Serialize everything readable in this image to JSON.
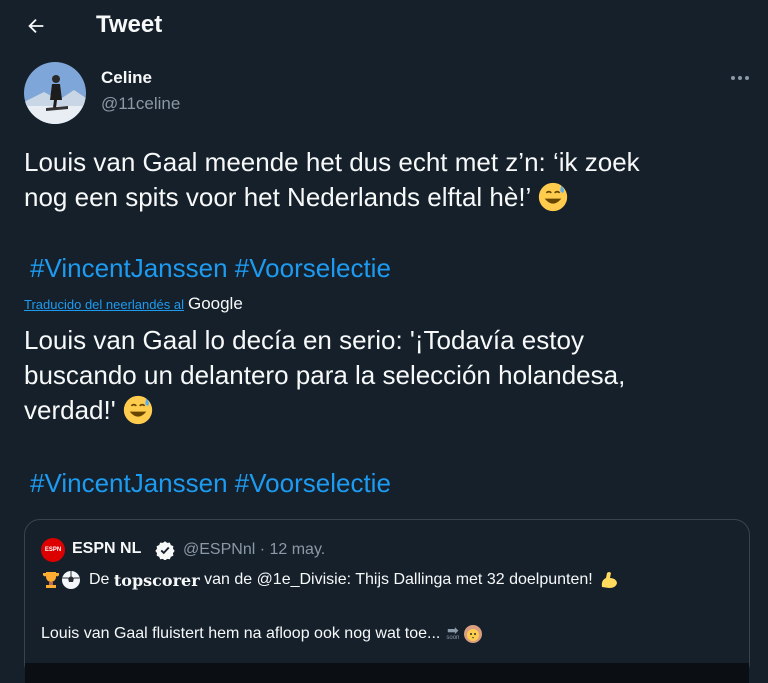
{
  "header": {
    "title": "Tweet",
    "back_icon": "arrow-left-icon"
  },
  "author": {
    "name": "Celine",
    "handle": "@11celine"
  },
  "tweet": {
    "text_line1": "Louis van Gaal meende het dus echt met z’n: ‘ik zoek",
    "text_line2": "nog een spits voor het Nederlands elftal hè!’",
    "hashtag1": "#VincentJanssen",
    "hashtag2": "#Voorselectie"
  },
  "translation": {
    "label": "Traducido del neerlandés al",
    "provider": "Google",
    "line1": "Louis van Gaal lo decía en serio: '¡Todavía estoy",
    "line2": "buscando un delantero para la selección holandesa,",
    "line3": "verdad!'",
    "hashtag1": "#VincentJanssen",
    "hashtag2": "#Voorselectie"
  },
  "quote": {
    "avatar_text": "ESPN",
    "name": "ESPN NL",
    "handle_date": "@ESPNnl · 12 may.",
    "line1_prefix": "De",
    "line1_bold": "topscorer",
    "line1_rest": "van de @1e_Divisie: Thijs Dallinga met 32 doelpunten!",
    "line2": "Louis van Gaal fluistert hem na afloop ook nog wat toe...",
    "line2_arrow_label": "soon"
  },
  "colors": {
    "background": "#15202b",
    "link": "#1d9bf0",
    "secondary": "#8b98a5",
    "border": "#38444d"
  }
}
